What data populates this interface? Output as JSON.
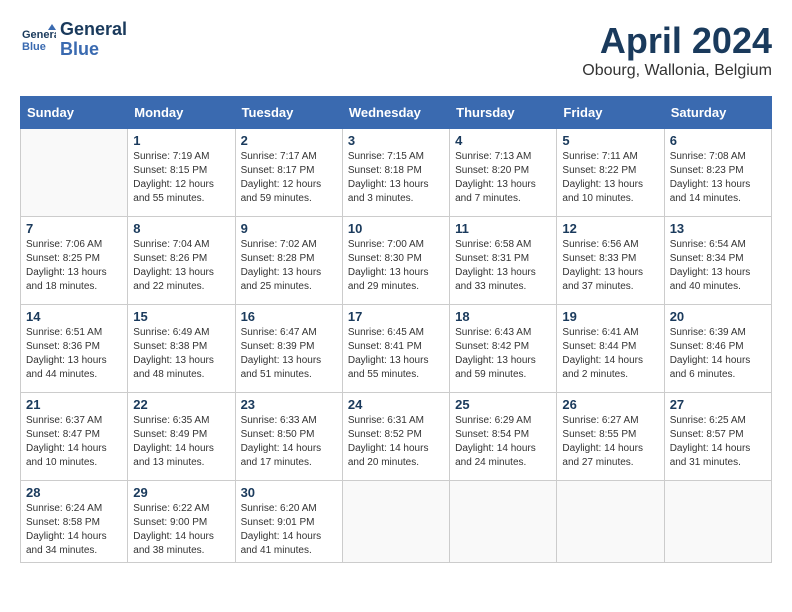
{
  "header": {
    "logo_line1": "General",
    "logo_line2": "Blue",
    "title": "April 2024",
    "subtitle": "Obourg, Wallonia, Belgium"
  },
  "weekdays": [
    "Sunday",
    "Monday",
    "Tuesday",
    "Wednesday",
    "Thursday",
    "Friday",
    "Saturday"
  ],
  "weeks": [
    [
      {
        "day": "",
        "info": ""
      },
      {
        "day": "1",
        "info": "Sunrise: 7:19 AM\nSunset: 8:15 PM\nDaylight: 12 hours\nand 55 minutes."
      },
      {
        "day": "2",
        "info": "Sunrise: 7:17 AM\nSunset: 8:17 PM\nDaylight: 12 hours\nand 59 minutes."
      },
      {
        "day": "3",
        "info": "Sunrise: 7:15 AM\nSunset: 8:18 PM\nDaylight: 13 hours\nand 3 minutes."
      },
      {
        "day": "4",
        "info": "Sunrise: 7:13 AM\nSunset: 8:20 PM\nDaylight: 13 hours\nand 7 minutes."
      },
      {
        "day": "5",
        "info": "Sunrise: 7:11 AM\nSunset: 8:22 PM\nDaylight: 13 hours\nand 10 minutes."
      },
      {
        "day": "6",
        "info": "Sunrise: 7:08 AM\nSunset: 8:23 PM\nDaylight: 13 hours\nand 14 minutes."
      }
    ],
    [
      {
        "day": "7",
        "info": "Sunrise: 7:06 AM\nSunset: 8:25 PM\nDaylight: 13 hours\nand 18 minutes."
      },
      {
        "day": "8",
        "info": "Sunrise: 7:04 AM\nSunset: 8:26 PM\nDaylight: 13 hours\nand 22 minutes."
      },
      {
        "day": "9",
        "info": "Sunrise: 7:02 AM\nSunset: 8:28 PM\nDaylight: 13 hours\nand 25 minutes."
      },
      {
        "day": "10",
        "info": "Sunrise: 7:00 AM\nSunset: 8:30 PM\nDaylight: 13 hours\nand 29 minutes."
      },
      {
        "day": "11",
        "info": "Sunrise: 6:58 AM\nSunset: 8:31 PM\nDaylight: 13 hours\nand 33 minutes."
      },
      {
        "day": "12",
        "info": "Sunrise: 6:56 AM\nSunset: 8:33 PM\nDaylight: 13 hours\nand 37 minutes."
      },
      {
        "day": "13",
        "info": "Sunrise: 6:54 AM\nSunset: 8:34 PM\nDaylight: 13 hours\nand 40 minutes."
      }
    ],
    [
      {
        "day": "14",
        "info": "Sunrise: 6:51 AM\nSunset: 8:36 PM\nDaylight: 13 hours\nand 44 minutes."
      },
      {
        "day": "15",
        "info": "Sunrise: 6:49 AM\nSunset: 8:38 PM\nDaylight: 13 hours\nand 48 minutes."
      },
      {
        "day": "16",
        "info": "Sunrise: 6:47 AM\nSunset: 8:39 PM\nDaylight: 13 hours\nand 51 minutes."
      },
      {
        "day": "17",
        "info": "Sunrise: 6:45 AM\nSunset: 8:41 PM\nDaylight: 13 hours\nand 55 minutes."
      },
      {
        "day": "18",
        "info": "Sunrise: 6:43 AM\nSunset: 8:42 PM\nDaylight: 13 hours\nand 59 minutes."
      },
      {
        "day": "19",
        "info": "Sunrise: 6:41 AM\nSunset: 8:44 PM\nDaylight: 14 hours\nand 2 minutes."
      },
      {
        "day": "20",
        "info": "Sunrise: 6:39 AM\nSunset: 8:46 PM\nDaylight: 14 hours\nand 6 minutes."
      }
    ],
    [
      {
        "day": "21",
        "info": "Sunrise: 6:37 AM\nSunset: 8:47 PM\nDaylight: 14 hours\nand 10 minutes."
      },
      {
        "day": "22",
        "info": "Sunrise: 6:35 AM\nSunset: 8:49 PM\nDaylight: 14 hours\nand 13 minutes."
      },
      {
        "day": "23",
        "info": "Sunrise: 6:33 AM\nSunset: 8:50 PM\nDaylight: 14 hours\nand 17 minutes."
      },
      {
        "day": "24",
        "info": "Sunrise: 6:31 AM\nSunset: 8:52 PM\nDaylight: 14 hours\nand 20 minutes."
      },
      {
        "day": "25",
        "info": "Sunrise: 6:29 AM\nSunset: 8:54 PM\nDaylight: 14 hours\nand 24 minutes."
      },
      {
        "day": "26",
        "info": "Sunrise: 6:27 AM\nSunset: 8:55 PM\nDaylight: 14 hours\nand 27 minutes."
      },
      {
        "day": "27",
        "info": "Sunrise: 6:25 AM\nSunset: 8:57 PM\nDaylight: 14 hours\nand 31 minutes."
      }
    ],
    [
      {
        "day": "28",
        "info": "Sunrise: 6:24 AM\nSunset: 8:58 PM\nDaylight: 14 hours\nand 34 minutes."
      },
      {
        "day": "29",
        "info": "Sunrise: 6:22 AM\nSunset: 9:00 PM\nDaylight: 14 hours\nand 38 minutes."
      },
      {
        "day": "30",
        "info": "Sunrise: 6:20 AM\nSunset: 9:01 PM\nDaylight: 14 hours\nand 41 minutes."
      },
      {
        "day": "",
        "info": ""
      },
      {
        "day": "",
        "info": ""
      },
      {
        "day": "",
        "info": ""
      },
      {
        "day": "",
        "info": ""
      }
    ]
  ]
}
